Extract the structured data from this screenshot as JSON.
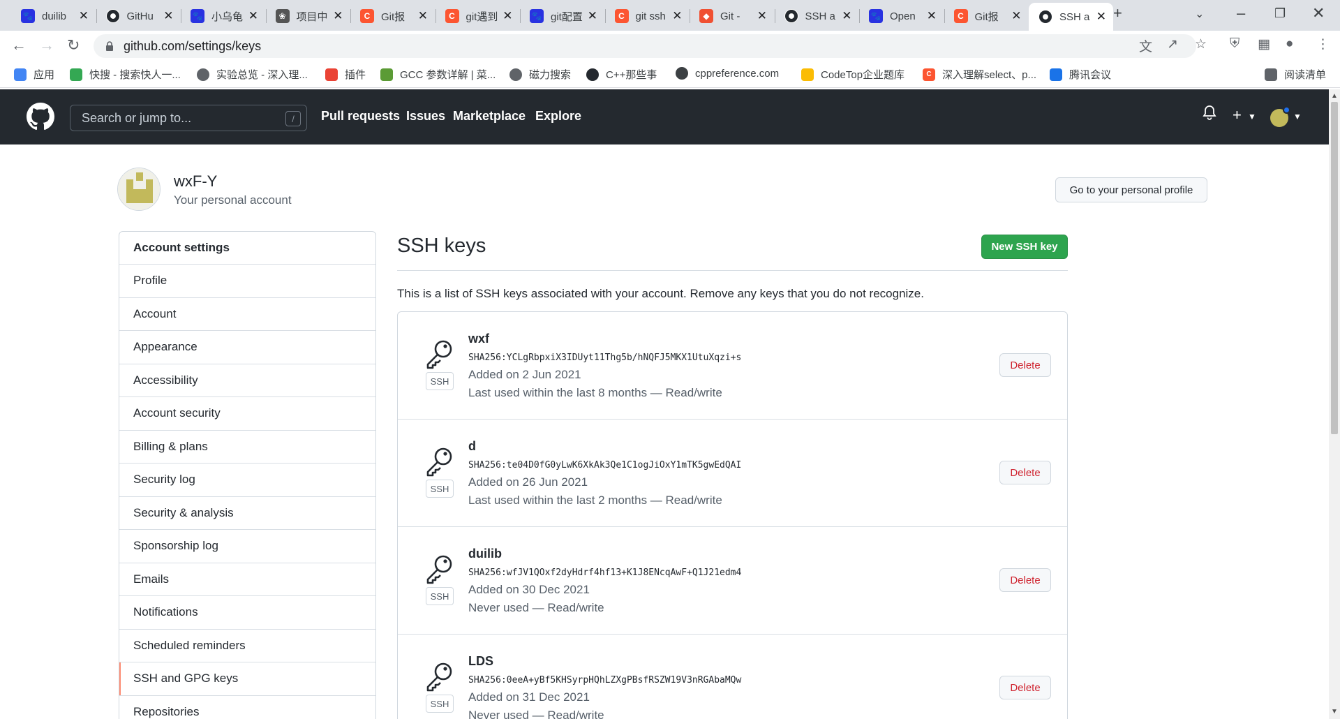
{
  "browser": {
    "tabs": [
      {
        "title": "duilib",
        "icon": "baidu-paw-icon",
        "color": "#2932e1"
      },
      {
        "title": "GitHu",
        "icon": "github-icon",
        "color": "#24292f"
      },
      {
        "title": "小乌龟",
        "icon": "baidu-paw-icon",
        "color": "#2932e1"
      },
      {
        "title": "项目中",
        "icon": "zhihu-icon",
        "color": "#555555"
      },
      {
        "title": "Git报",
        "icon": "csdn-icon",
        "color": "#fc5531"
      },
      {
        "title": "git遇到",
        "icon": "csdn-icon",
        "color": "#fc5531"
      },
      {
        "title": "git配置",
        "icon": "baidu-paw-icon",
        "color": "#2932e1"
      },
      {
        "title": "git ssh",
        "icon": "csdn-icon",
        "color": "#fc5531"
      },
      {
        "title": "Git - ",
        "icon": "git-icon",
        "color": "#f05032"
      },
      {
        "title": "SSH a",
        "icon": "github-icon",
        "color": "#24292f"
      },
      {
        "title": "Open",
        "icon": "baidu-paw-icon",
        "color": "#2932e1"
      },
      {
        "title": "Git报",
        "icon": "csdn-icon",
        "color": "#fc5531"
      },
      {
        "title": "SSH a",
        "icon": "github-icon",
        "color": "#24292f",
        "active": true
      }
    ],
    "url": "github.com/settings/keys",
    "bookmarks": [
      {
        "label": "应用",
        "icon": "apps-grid-icon"
      },
      {
        "label": "快搜 - 搜索快人一...",
        "icon": "quick-search-icon"
      },
      {
        "label": "实验总览 - 深入理...",
        "icon": "globe-icon"
      },
      {
        "label": "插件",
        "icon": "rainbow-icon"
      },
      {
        "label": "GCC 参数详解 | 菜...",
        "icon": "runoob-icon"
      },
      {
        "label": "磁力搜索",
        "icon": "globe-icon"
      },
      {
        "label": "C++那些事",
        "icon": "github-icon"
      },
      {
        "label": "cppreference.com",
        "icon": "cppreference-icon"
      },
      {
        "label": "CodeTop企业题库",
        "icon": "bar-chart-icon"
      },
      {
        "label": "深入理解select、p...",
        "icon": "csdn-icon"
      },
      {
        "label": "腾讯会议",
        "icon": "tencent-meeting-icon"
      },
      {
        "label": "阅读清单",
        "icon": "reading-list-icon"
      }
    ]
  },
  "header": {
    "search_placeholder": "Search or jump to...",
    "search_shortcut": "/",
    "nav": [
      "Pull requests",
      "Issues",
      "Marketplace",
      "Explore"
    ]
  },
  "user": {
    "name": "wxF-Y",
    "subtitle": "Your personal account",
    "profile_button": "Go to your personal profile"
  },
  "menu": {
    "heading": "Account settings",
    "items": [
      "Profile",
      "Account",
      "Appearance",
      "Accessibility",
      "Account security",
      "Billing & plans",
      "Security log",
      "Security & analysis",
      "Sponsorship log",
      "Emails",
      "Notifications",
      "Scheduled reminders",
      "SSH and GPG keys",
      "Repositories"
    ],
    "selected": "SSH and GPG keys"
  },
  "main": {
    "title": "SSH keys",
    "new_button": "New SSH key",
    "intro": "This is a list of SSH keys associated with your account. Remove any keys that you do not recognize.",
    "badge": "SSH",
    "delete_label": "Delete",
    "keys": [
      {
        "name": "wxf",
        "fingerprint": "SHA256:YCLgRbpxiX3IDUyt11Thg5b/hNQFJ5MKX1UtuXqzi+s",
        "added": "Added on 2 Jun 2021",
        "used": "Last used within the last 8 months — Read/write"
      },
      {
        "name": "d",
        "fingerprint": "SHA256:te04D0fG0yLwK6XkAk3Qe1C1ogJiOxY1mTK5gwEdQAI",
        "added": "Added on 26 Jun 2021",
        "used": "Last used within the last 2 months — Read/write"
      },
      {
        "name": "duilib",
        "fingerprint": "SHA256:wfJV1QOxf2dyHdrf4hf13+K1J8ENcqAwF+Q1J21edm4",
        "added": "Added on 30 Dec 2021",
        "used": "Never used — Read/write"
      },
      {
        "name": "LDS",
        "fingerprint": "SHA256:0eeA+yBf5KHSyrpHQhLZXgPBsfRSZW19V3nRGAbaMQw",
        "added": "Added on 31 Dec 2021",
        "used": "Never used — Read/write"
      }
    ]
  },
  "colors": {
    "header_bg": "#24292f",
    "primary_button": "#2da44e",
    "danger_text": "#cf222e",
    "selected_accent": "#fd8c73"
  }
}
